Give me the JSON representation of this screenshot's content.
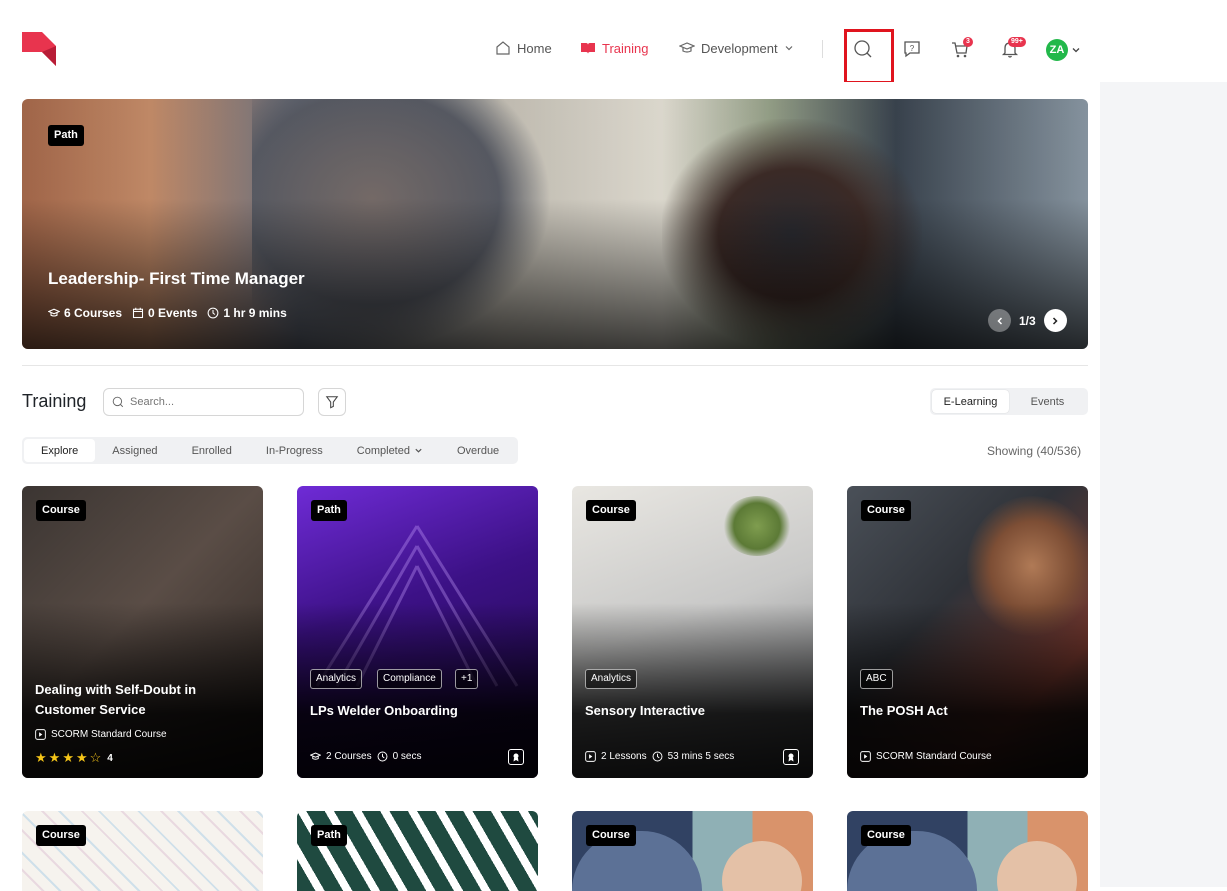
{
  "nav": {
    "home": "Home",
    "training": "Training",
    "development": "Development",
    "cart_badge": "3",
    "notif_badge": "99+",
    "avatar": "ZA"
  },
  "hero": {
    "tag": "Path",
    "title": "Leadership- First Time Manager",
    "courses": "6 Courses",
    "events": "0 Events",
    "duration": "1 hr 9 mins",
    "pager": "1/3"
  },
  "training": {
    "title": "Training",
    "search_placeholder": "Search...",
    "segments": [
      "E-Learning",
      "Events"
    ],
    "tabs": [
      "Explore",
      "Assigned",
      "Enrolled",
      "In-Progress",
      "Completed",
      "Overdue"
    ],
    "showing": "Showing (40/536)"
  },
  "cards": [
    {
      "tag": "Course",
      "title_line1": "Dealing with Self-Doubt in",
      "title_line2": "Customer Service",
      "meta": "SCORM Standard Course",
      "rating": 4,
      "rating_label": "4",
      "colors": [
        "#2b2624",
        "#5b4f49"
      ]
    },
    {
      "tag": "Path",
      "chips": [
        "Analytics",
        "Compliance",
        "+1"
      ],
      "title": "LPs Welder Onboarding",
      "meta1": "2 Courses",
      "meta2": "0 secs",
      "colors": [
        "#2a0f5a",
        "#6d2bd4"
      ]
    },
    {
      "tag": "Course",
      "chips": [
        "Analytics"
      ],
      "title": "Sensory Interactive",
      "meta1": "2 Lessons",
      "meta2": "53 mins 5 secs",
      "colors": [
        "#c7c9cc",
        "#e8e6e0"
      ]
    },
    {
      "tag": "Course",
      "chips": [
        "ABC"
      ],
      "title": "The POSH Act",
      "meta": "SCORM Standard Course",
      "colors": [
        "#3a3f46",
        "#8a5a45"
      ]
    }
  ],
  "cards_row2": [
    {
      "tag": "Course"
    },
    {
      "tag": "Path"
    },
    {
      "tag": "Course"
    },
    {
      "tag": "Course"
    }
  ]
}
